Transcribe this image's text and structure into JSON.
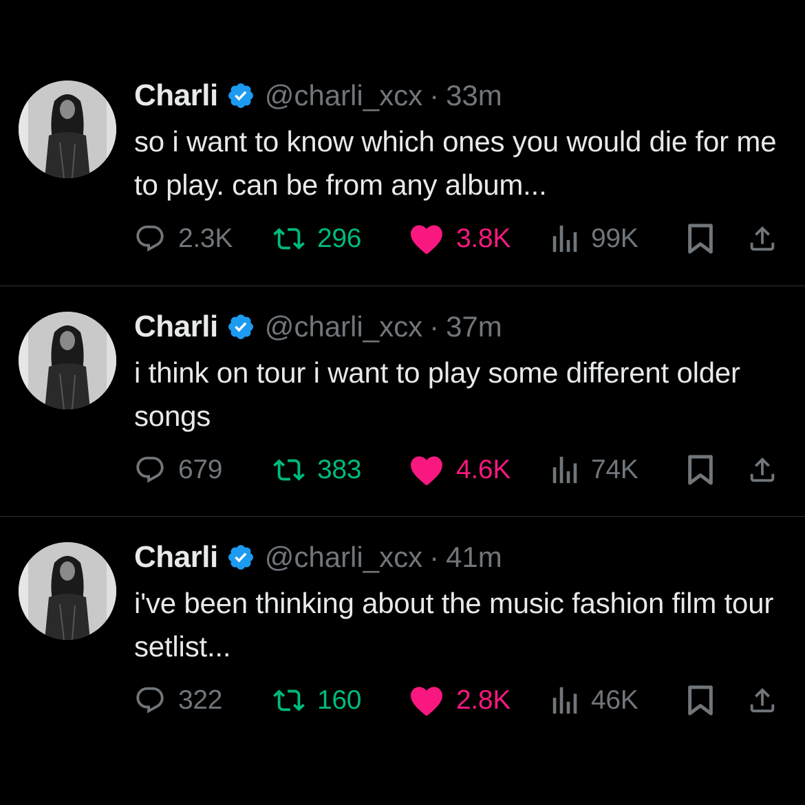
{
  "colors": {
    "background": "#000000",
    "text_primary": "#e7e9ea",
    "text_secondary": "#71767b",
    "verified_blue": "#1d9bf0",
    "retweet_green": "#00ba7c",
    "like_pink": "#f91880",
    "divider": "#2f3336"
  },
  "tweets": [
    {
      "name": "Charli",
      "handle": "@charli_xcx",
      "separator": "·",
      "time": "33m",
      "text": "so i want to know which ones you would die for me to play. can be from any album...",
      "replies": "2.3K",
      "retweets": "296",
      "likes": "3.8K",
      "views": "99K",
      "liked": true
    },
    {
      "name": "Charli",
      "handle": "@charli_xcx",
      "separator": "·",
      "time": "37m",
      "text": "i think on tour i want to play some different older songs",
      "replies": "679",
      "retweets": "383",
      "likes": "4.6K",
      "views": "74K",
      "liked": true
    },
    {
      "name": "Charli",
      "handle": "@charli_xcx",
      "separator": "·",
      "time": "41m",
      "text": "i've been thinking about the music fashion film tour setlist...",
      "replies": "322",
      "retweets": "160",
      "likes": "2.8K",
      "views": "46K",
      "liked": true
    }
  ],
  "icons": {
    "reply": "reply-icon",
    "retweet": "retweet-icon",
    "like": "heart-icon",
    "views": "views-icon",
    "bookmark": "bookmark-icon",
    "share": "share-icon",
    "verified": "verified-badge-icon"
  }
}
